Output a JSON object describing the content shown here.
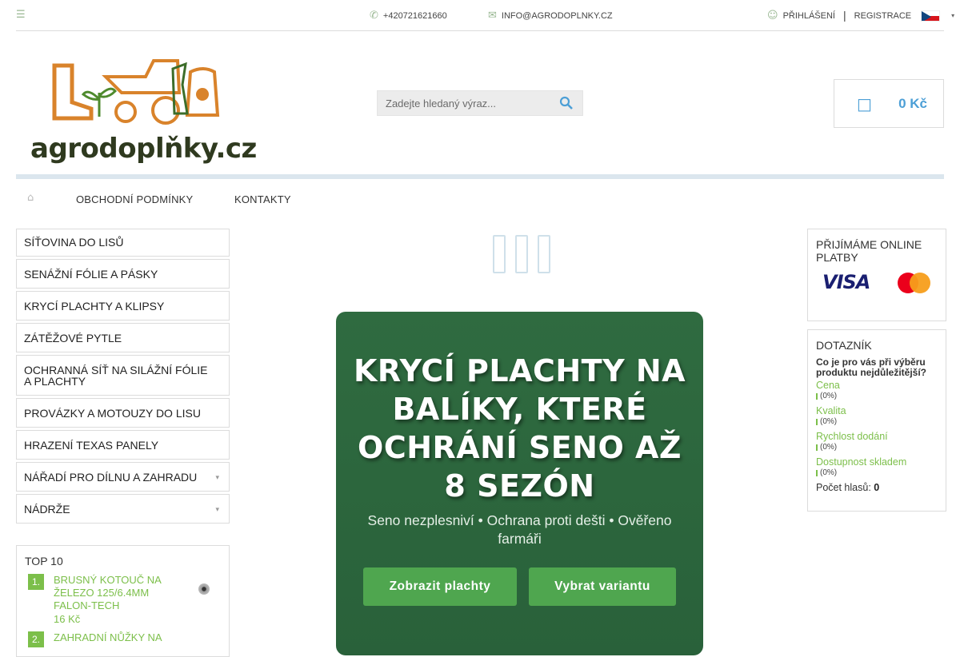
{
  "topbar": {
    "phone": "+420721621660",
    "email": "INFO@AGRODOPLNKY.CZ",
    "login": "PŘIHLÁŠENÍ",
    "register": "REGISTRACE",
    "separator": "|"
  },
  "logo": {
    "text": "agrodoplňky.cz"
  },
  "search": {
    "placeholder": "Zadejte hledaný výraz..."
  },
  "cart": {
    "total": "0 Kč"
  },
  "nav": {
    "items": [
      "OBCHODNÍ PODMÍNKY",
      "KONTAKTY"
    ]
  },
  "categories": [
    "SÍŤOVINA DO LISŮ",
    "SENÁŽNÍ FÓLIE A PÁSKY",
    "KRYCÍ PLACHTY A KLIPSY",
    "ZÁTĚŽOVÉ PYTLE",
    "OCHRANNÁ SÍŤ NA SILÁŽNÍ FÓLIE A PLACHTY",
    "PROVÁZKY A MOTOUZY DO LISU",
    "HRAZENÍ TEXAS PANELY",
    "NÁŘADÍ PRO DÍLNU A ZAHRADU",
    "NÁDRŽE"
  ],
  "top10": {
    "title": "TOP 10",
    "items": [
      {
        "num": "1.",
        "name": "BRUSNÝ KOTOUČ NA ŽELEZO 125/6.4MM FALON-TECH",
        "price": "16 Kč"
      },
      {
        "num": "2.",
        "name": "ZAHRADNÍ NŮŽKY NA",
        "price": ""
      }
    ]
  },
  "hero": {
    "title": "KRYCÍ PLACHTY NA BALÍKY, KTERÉ OCHRÁNÍ SENO AŽ 8 SEZÓN",
    "subtitle": "Seno nezplesniví • Ochrana proti dešti • Ověřeno farmáři",
    "button_primary": "Zobrazit plachty",
    "button_secondary": "Vybrat variantu",
    "bg_color": "#2f6b40",
    "button_color": "#4fa64f"
  },
  "payments": {
    "title": "PŘIJÍMÁME ONLINE PLATBY",
    "visa": "VISA"
  },
  "survey": {
    "title": "DOTAZNÍK",
    "question": "Co je pro vás při výběru produktu nejdůležitější?",
    "options": [
      {
        "label": "Cena",
        "result": "(0%)"
      },
      {
        "label": "Kvalita",
        "result": "(0%)"
      },
      {
        "label": "Rychlost dodání",
        "result": "(0%)"
      },
      {
        "label": "Dostupnost skladem",
        "result": "(0%)"
      }
    ],
    "votes_label": "Počet hlasů:",
    "votes_count": "0"
  },
  "colors": {
    "accent_green": "#7cbf4a",
    "accent_blue": "#4c9fd6",
    "icon_green": "#9ab893"
  }
}
